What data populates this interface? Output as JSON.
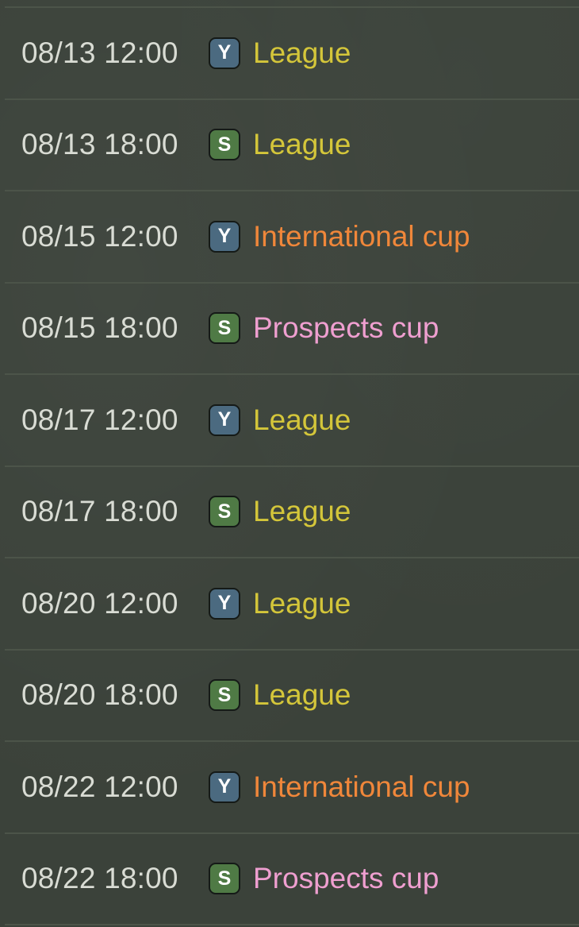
{
  "colors": {
    "league": "#d4c63a",
    "international_cup": "#f0873a",
    "prospects_cup": "#ef9fd0",
    "badge_y": "#4b6a80",
    "badge_s": "#4f7a45"
  },
  "matches": [
    {
      "datetime": "08/13 12:00",
      "team_badge": "Y",
      "competition": "League"
    },
    {
      "datetime": "08/13 18:00",
      "team_badge": "S",
      "competition": "League"
    },
    {
      "datetime": "08/15 12:00",
      "team_badge": "Y",
      "competition": "International cup"
    },
    {
      "datetime": "08/15 18:00",
      "team_badge": "S",
      "competition": "Prospects cup"
    },
    {
      "datetime": "08/17 12:00",
      "team_badge": "Y",
      "competition": "League"
    },
    {
      "datetime": "08/17 18:00",
      "team_badge": "S",
      "competition": "League"
    },
    {
      "datetime": "08/20 12:00",
      "team_badge": "Y",
      "competition": "League"
    },
    {
      "datetime": "08/20 18:00",
      "team_badge": "S",
      "competition": "League"
    },
    {
      "datetime": "08/22 12:00",
      "team_badge": "Y",
      "competition": "International cup"
    },
    {
      "datetime": "08/22 18:00",
      "team_badge": "S",
      "competition": "Prospects cup"
    }
  ]
}
